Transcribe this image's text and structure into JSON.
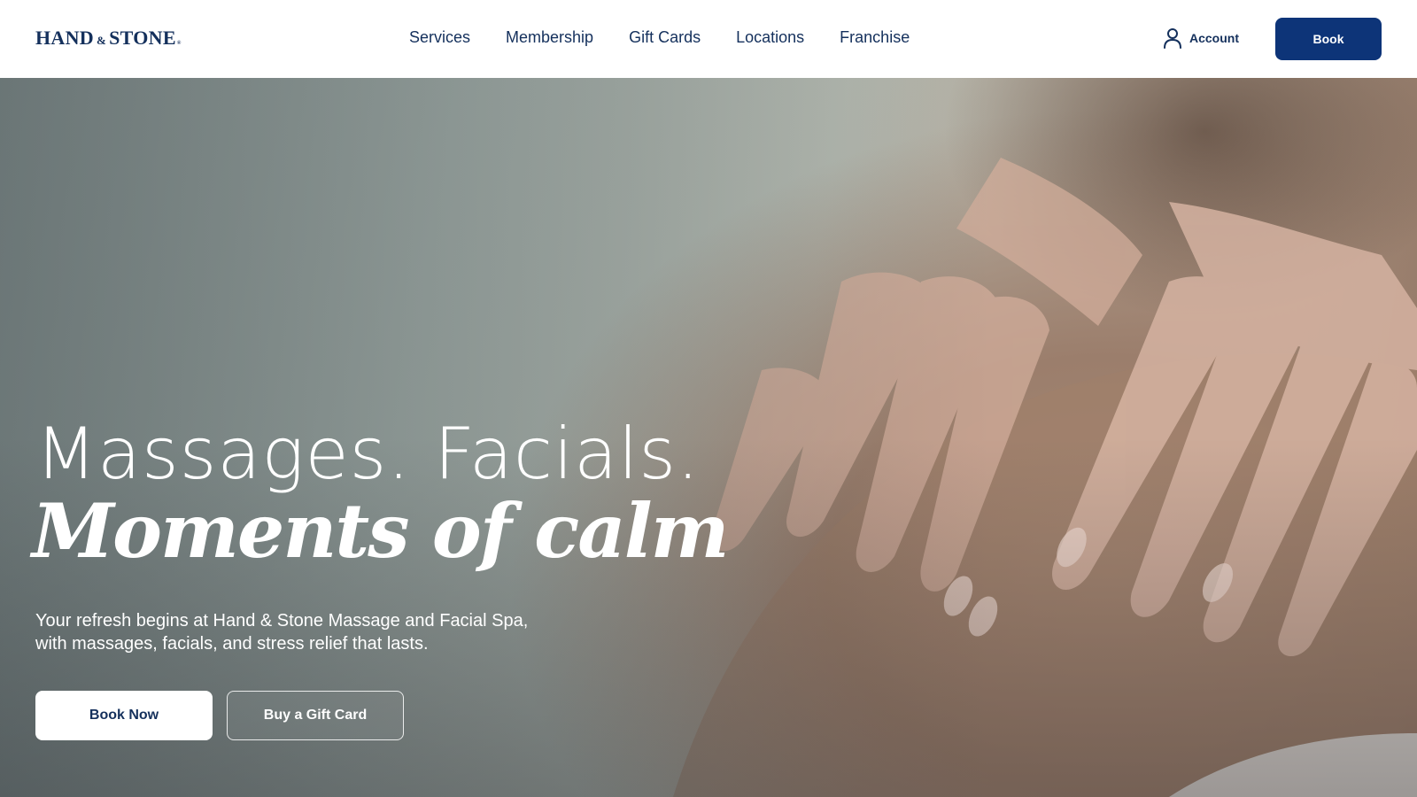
{
  "brand": {
    "logo_part1": "HAND",
    "logo_amp": "&",
    "logo_part2": "STONE",
    "logo_reg": "®",
    "color": "#14305c"
  },
  "nav": {
    "items": [
      {
        "label": "Services"
      },
      {
        "label": "Membership"
      },
      {
        "label": "Gift Cards"
      },
      {
        "label": "Locations"
      },
      {
        "label": "Franchise"
      }
    ]
  },
  "header_actions": {
    "account_label": "Account",
    "account_icon": "user-icon",
    "book_label": "Book",
    "book_color": "#0d3478"
  },
  "hero": {
    "headline": "Massages. Facials.",
    "headline_italic": "Moments of calm",
    "subtext_line1": "Your refresh begins at Hand & Stone Massage and Facial Spa,",
    "subtext_line2": "with massages, facials, and stress relief that lasts.",
    "primary_cta": "Book Now",
    "secondary_cta": "Buy a Gift Card"
  }
}
